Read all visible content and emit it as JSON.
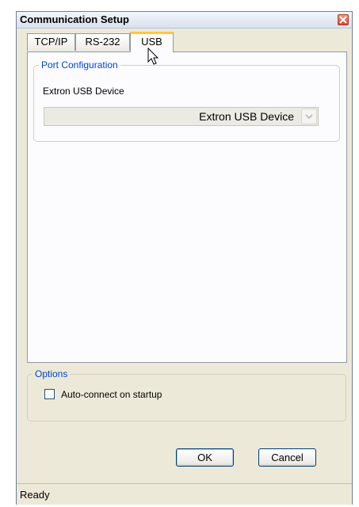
{
  "window": {
    "title": "Communication Setup"
  },
  "tabs": [
    {
      "label": "TCP/IP",
      "active": false
    },
    {
      "label": "RS-232",
      "active": false
    },
    {
      "label": "USB",
      "active": true
    }
  ],
  "port_config": {
    "legend": "Port Configuration",
    "device_label": "Extron USB Device",
    "device_select_value": "Extron USB Device"
  },
  "options": {
    "legend": "Options",
    "auto_connect_label": "Auto-connect on startup",
    "auto_connect_checked": false
  },
  "buttons": {
    "ok": "OK",
    "cancel": "Cancel"
  },
  "status": {
    "text": "Ready"
  },
  "icons": {
    "close": "close-icon",
    "dropdown": "chevron-down-icon",
    "cursor": "mouse-pointer-icon"
  },
  "colors": {
    "active_tab_accent": "#ffc83c",
    "close_button": "#d9452b",
    "group_legend": "#0046d5"
  }
}
